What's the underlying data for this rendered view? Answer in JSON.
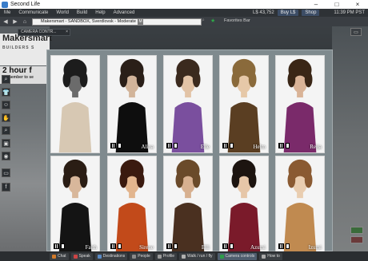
{
  "window": {
    "title": "Second Life",
    "controls": [
      "–",
      "□",
      "×"
    ]
  },
  "menu": {
    "items": [
      "Me",
      "Communicate",
      "World",
      "Build",
      "Help",
      "Advanced"
    ],
    "balance": "L$ 43,752",
    "buy_label": "Buy L$",
    "shop_label": "Shop",
    "clock": "11:39 PM PST"
  },
  "nav": {
    "location": "Makersmart - SANDBOX, Sverdlovsk - Moderate",
    "rating_badge": "M",
    "favorites_label": "Favorites Bar"
  },
  "camera_tab": {
    "title": "CAMERA CONTR..."
  },
  "scenery": {
    "sign_title": "Makersmart",
    "sign_subtitle": "BUILDERS S",
    "hour_title": "2 hour f",
    "hour_subtitle": "(remember to se"
  },
  "gallery": {
    "cards": [
      {
        "name": "",
        "palette": [
          "#1c1c1c",
          "#d7c8b3",
          "#6b6b6b"
        ]
      },
      {
        "name": "Alina",
        "palette": [
          "#2a1f18",
          "#0e0e0e",
          "#d2b49a"
        ]
      },
      {
        "name": "Elle",
        "palette": [
          "#3b2a1e",
          "#7a4f9e",
          "#e2c3a6"
        ]
      },
      {
        "name": "Helm",
        "palette": [
          "#8a6a3b",
          "#5a3e22",
          "#e6c8a8"
        ]
      },
      {
        "name": "Reija",
        "palette": [
          "#3a2616",
          "#7a2a6a",
          "#d9b397"
        ]
      },
      {
        "name": "Faith",
        "palette": [
          "#2a1d14",
          "#141414",
          "#d8b79b"
        ]
      },
      {
        "name": "Sirene",
        "palette": [
          "#3a1a0f",
          "#c24a1a",
          "#e2b58e"
        ]
      },
      {
        "name": "Elli",
        "palette": [
          "#6a4a2a",
          "#4a3020",
          "#d7b090"
        ]
      },
      {
        "name": "Azumi",
        "palette": [
          "#1c1410",
          "#7a1a2a",
          "#e6c6a8"
        ]
      },
      {
        "name": "Izumi",
        "palette": [
          "#8a5a32",
          "#c08a50",
          "#e9cdb0"
        ]
      }
    ]
  },
  "toolbar": {
    "buttons": [
      {
        "label": "Chat",
        "active": false
      },
      {
        "label": "Speak",
        "active": false
      },
      {
        "label": "Destinations",
        "active": false
      },
      {
        "label": "People",
        "active": false
      },
      {
        "label": "Profile",
        "active": false
      },
      {
        "label": "Walk / run / fly",
        "active": false
      },
      {
        "label": "Camera controls",
        "active": true
      },
      {
        "label": "How to",
        "active": false
      }
    ]
  },
  "left_tools": [
    "search-icon",
    "people-icon",
    "shirt-icon",
    "gesture-icon",
    "inventory-icon",
    "map-icon",
    "snapshot-icon",
    "camera-icon",
    "facebook-icon"
  ]
}
